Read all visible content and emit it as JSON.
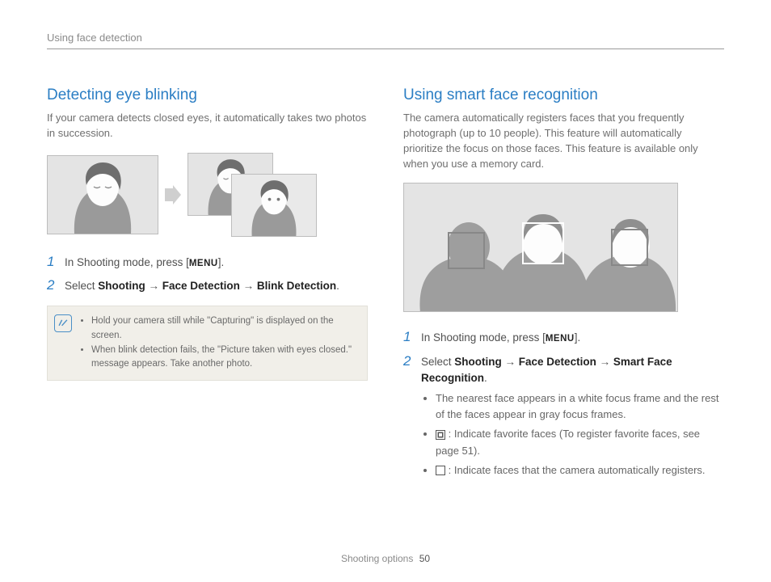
{
  "header": {
    "breadcrumb": "Using face detection"
  },
  "left": {
    "heading": "Detecting eye blinking",
    "intro": "If your camera detects closed eyes, it automatically takes two photos in succession.",
    "step1_pre": "In Shooting mode, press [",
    "menu_label": "MENU",
    "step1_post": "].",
    "step2_a": "Select ",
    "step2_b1": "Shooting",
    "step2_arrow": " → ",
    "step2_b2": "Face Detection",
    "step2_b3": "Blink Detection",
    "step2_end": ".",
    "note1_a": "Hold your camera still while \"",
    "note1_b": "Capturing",
    "note1_c": "\" is displayed on the screen.",
    "note2_a": "When blink detection fails, the \"",
    "note2_b": "Picture taken with eyes closed.",
    "note2_c": "\" message appears. Take another photo."
  },
  "right": {
    "heading": "Using smart face recognition",
    "intro": "The camera automatically registers faces that you frequently photograph (up to 10 people). This feature will automatically prioritize the focus on those faces. This feature is available only when you use a memory card.",
    "step1_pre": "In Shooting mode, press [",
    "menu_label": "MENU",
    "step1_post": "].",
    "step2_a": "Select ",
    "step2_b1": "Shooting",
    "step2_arrow": " → ",
    "step2_b2": "Face Detection",
    "step2_b3": "Smart Face Recognition",
    "step2_end": ".",
    "bullet1": "The nearest face appears in a white focus frame and the rest of the faces appear in gray focus frames.",
    "bullet2": " : Indicate favorite faces (To register favorite faces, see page 51).",
    "bullet3": " : Indicate faces that the camera automatically registers."
  },
  "footer": {
    "section": "Shooting options",
    "page": "50"
  }
}
